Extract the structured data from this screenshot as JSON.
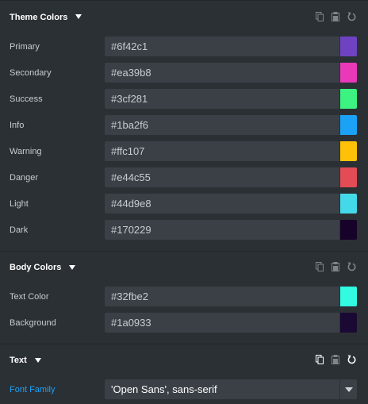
{
  "sections": {
    "theme": {
      "title": "Theme Colors",
      "rows": [
        {
          "label": "Primary",
          "value": "#6f42c1",
          "swatch": "#6f42c1"
        },
        {
          "label": "Secondary",
          "value": "#ea39b8",
          "swatch": "#ea39b8"
        },
        {
          "label": "Success",
          "value": "#3cf281",
          "swatch": "#3cf281"
        },
        {
          "label": "Info",
          "value": "#1ba2f6",
          "swatch": "#1ba2f6"
        },
        {
          "label": "Warning",
          "value": "#ffc107",
          "swatch": "#ffc107"
        },
        {
          "label": "Danger",
          "value": "#e44c55",
          "swatch": "#e44c55"
        },
        {
          "label": "Light",
          "value": "#44d9e8",
          "swatch": "#44d9e8"
        },
        {
          "label": "Dark",
          "value": "#170229",
          "swatch": "#170229"
        }
      ]
    },
    "body": {
      "title": "Body Colors",
      "rows": [
        {
          "label": "Text Color",
          "value": "#32fbe2",
          "swatch": "#32fbe2"
        },
        {
          "label": "Background",
          "value": "#1a0933",
          "swatch": "#1a0933"
        }
      ]
    },
    "text": {
      "title": "Text",
      "font_family_label": "Font Family",
      "font_family_value": "'Open Sans', sans-serif"
    }
  },
  "icons": {
    "copy": "copy-icon",
    "paste": "paste-icon",
    "reset": "reset-icon"
  },
  "colors": {
    "panel_bg": "#2b3035",
    "input_bg": "#3b4046",
    "accent_label": "#1ba2f6"
  }
}
